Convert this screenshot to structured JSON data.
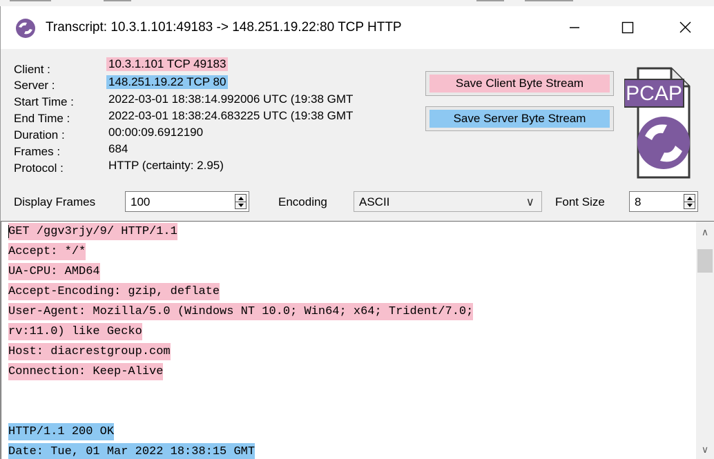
{
  "window": {
    "title": "Transcript: 10.3.1.101:49183 -> 148.251.19.22:80 TCP HTTP",
    "app_icon": "networkminer-icon",
    "controls": {
      "minimize": "minimize-icon",
      "maximize": "maximize-icon",
      "close": "close-icon"
    }
  },
  "details": {
    "client_label": "Client :",
    "client_value": "10.3.1.101 TCP 49183",
    "server_label": "Server :",
    "server_value": "148.251.19.22 TCP 80",
    "start_time_label": "Start Time :",
    "start_time_value": "2022-03-01 18:38:14.992006 UTC   (19:38 GMT",
    "end_time_label": "End Time :",
    "end_time_value": "2022-03-01 18:38:24.683225 UTC   (19:38 GMT",
    "duration_label": "Duration :",
    "duration_value": "00:00:09.6912190",
    "frames_label": "Frames :",
    "frames_value": "684",
    "protocol_label": "Protocol :",
    "protocol_value": "HTTP (certainty: 2.95)"
  },
  "buttons": {
    "save_client": "Save Client Byte Stream",
    "save_server": "Save Server Byte Stream"
  },
  "logo": {
    "text": "PCAP",
    "icon": "pcap-file-icon"
  },
  "controls": {
    "display_frames_label": "Display Frames",
    "display_frames_value": "100",
    "encoding_label": "Encoding",
    "encoding_value": "ASCII",
    "font_size_label": "Font Size",
    "font_size_value": "8"
  },
  "colors": {
    "client": "#f7bfcd",
    "server": "#8dc8f2"
  },
  "transcript": {
    "client_lines": [
      "GET /ggv3rjy/9/ HTTP/1.1",
      "Accept: */*",
      "UA-CPU: AMD64",
      "Accept-Encoding: gzip, deflate",
      "User-Agent: Mozilla/5.0 (Windows NT 10.0; Win64; x64; Trident/7.0;",
      "rv:11.0) like Gecko",
      "Host: diacrestgroup.com",
      "Connection: Keep-Alive"
    ],
    "server_lines": [
      "HTTP/1.1 200 OK",
      "Date: Tue, 01 Mar 2022 18:38:15 GMT"
    ]
  }
}
